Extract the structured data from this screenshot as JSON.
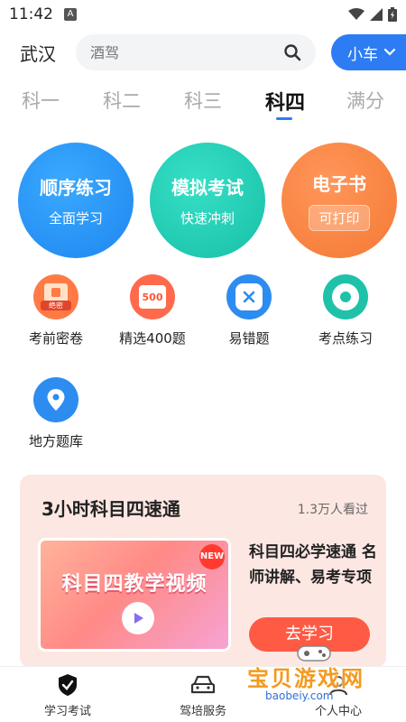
{
  "status_bar": {
    "time": "11:42",
    "notification_glyph": "A"
  },
  "header": {
    "city": "武汉",
    "search_placeholder": "酒驾",
    "vehicle_label": "小车"
  },
  "tabs": [
    {
      "label": "科一"
    },
    {
      "label": "科二"
    },
    {
      "label": "科三"
    },
    {
      "label": "科四"
    },
    {
      "label": "满分"
    }
  ],
  "active_tab": "科四",
  "main_actions": [
    {
      "title": "顺序练习",
      "subtitle": "全面学习",
      "color": "#1f86f0"
    },
    {
      "title": "模拟考试",
      "subtitle": "快速冲刺",
      "color": "#17bfa7"
    },
    {
      "title": "电子书",
      "subtitle": "可打印",
      "color": "#f47934"
    }
  ],
  "grid": [
    {
      "label": "考前密卷",
      "icon": "secret-paper-icon",
      "badge": "绝密",
      "color": "#ff7a45"
    },
    {
      "label": "精选400题",
      "icon": "selected-400-icon",
      "badge": "500",
      "color": "#ff6a4d"
    },
    {
      "label": "易错题",
      "icon": "wrong-question-icon",
      "color": "#2d8cf0"
    },
    {
      "label": "考点练习",
      "icon": "exam-point-icon",
      "color": "#1fc2a8"
    },
    {
      "label": "地方题库",
      "icon": "location-pin-icon",
      "color": "#2d8cf0"
    }
  ],
  "promo": {
    "title": "3小时科目四速通",
    "views": "1.3万人看过",
    "thumb_text": "科目四教学视频",
    "badge": "NEW",
    "description": "科目四必学速通 名师讲解、易考专项",
    "button": "去学习"
  },
  "bottom_nav": [
    {
      "label": "学习考试",
      "icon": "shield-check-icon"
    },
    {
      "label": "驾培服务",
      "icon": "car-icon"
    },
    {
      "label": "个人中心",
      "icon": "user-icon"
    }
  ],
  "watermark": {
    "text": "宝贝游戏网",
    "sub": "baobeiy.com"
  }
}
